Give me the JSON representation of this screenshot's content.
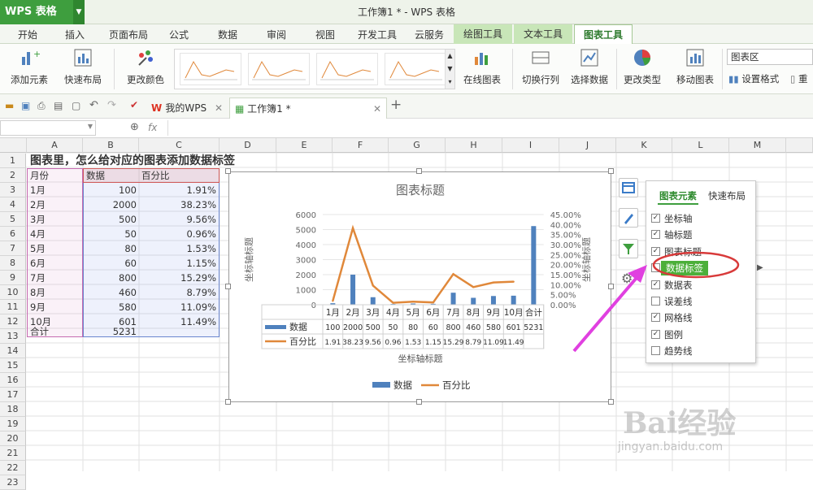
{
  "app": {
    "name": "WPS 表格",
    "window_title": "工作簿1 * - WPS 表格"
  },
  "ribbon_tabs": [
    "开始",
    "插入",
    "页面布局",
    "公式",
    "数据",
    "审阅",
    "视图",
    "开发工具",
    "云服务",
    "绘图工具",
    "文本工具",
    "图表工具"
  ],
  "active_tab": "图表工具",
  "ribbon": {
    "add_element": "添加元素",
    "quick_layout": "快速布局",
    "change_color": "更改颜色",
    "online_chart": "在线图表",
    "switch_row_col": "切换行列",
    "select_data": "选择数据",
    "change_type": "更改类型",
    "move_chart": "移动图表",
    "set_format": "设置格式",
    "reset": "重",
    "element_selector": "图表区"
  },
  "doc_tabs": [
    {
      "label": "我的WPS"
    },
    {
      "label": "工作簿1 *"
    }
  ],
  "formula": {
    "fx": "fx"
  },
  "columns": [
    "A",
    "B",
    "C",
    "D",
    "E",
    "F",
    "G",
    "H",
    "I",
    "J",
    "K",
    "L",
    "M"
  ],
  "rows": [
    "1",
    "2",
    "3",
    "4",
    "5",
    "6",
    "7",
    "8",
    "9",
    "10",
    "11",
    "12",
    "13",
    "14",
    "15",
    "16",
    "17",
    "18",
    "19",
    "20",
    "21",
    "22",
    "23"
  ],
  "sheet": {
    "title": "图表里，怎么给对应的图表添加数据标签",
    "headers": [
      "月份",
      "数据",
      "百分比"
    ],
    "data": [
      [
        "1月",
        "100",
        "1.91%"
      ],
      [
        "2月",
        "2000",
        "38.23%"
      ],
      [
        "3月",
        "500",
        "9.56%"
      ],
      [
        "4月",
        "50",
        "0.96%"
      ],
      [
        "5月",
        "80",
        "1.53%"
      ],
      [
        "6月",
        "60",
        "1.15%"
      ],
      [
        "7月",
        "800",
        "15.29%"
      ],
      [
        "8月",
        "460",
        "8.79%"
      ],
      [
        "9月",
        "580",
        "11.09%"
      ],
      [
        "10月",
        "601",
        "11.49%"
      ]
    ],
    "total_label": "合计",
    "total_value": "5231"
  },
  "chart_data": {
    "type": "bar",
    "title": "图表标题",
    "xlabel": "坐标轴标题",
    "ylabel": "坐标轴标题",
    "y2label": "坐标轴标题",
    "categories": [
      "1月",
      "2月",
      "3月",
      "4月",
      "5月",
      "6月",
      "7月",
      "8月",
      "9月",
      "10月",
      "合计"
    ],
    "ylim": [
      0,
      6000
    ],
    "y2lim": [
      0,
      45
    ],
    "yticks": [
      "6000",
      "5000",
      "4000",
      "3000",
      "2000",
      "1000",
      "0"
    ],
    "y2ticks": [
      "45.00%",
      "40.00%",
      "35.00%",
      "30.00%",
      "25.00%",
      "20.00%",
      "15.00%",
      "10.00%",
      "5.00%",
      "0.00%"
    ],
    "series": [
      {
        "name": "数据",
        "type": "bar",
        "axis": "left",
        "color": "#4f81bd",
        "values": [
          100,
          2000,
          500,
          50,
          80,
          60,
          800,
          460,
          580,
          601,
          5231
        ],
        "labels": [
          "100",
          "2000",
          "500",
          "50",
          "80",
          "60",
          "800",
          "460",
          "580",
          "601",
          "5231"
        ]
      },
      {
        "name": "百分比",
        "type": "line",
        "axis": "right",
        "color": "#e0883a",
        "values": [
          1.91,
          38.23,
          9.56,
          0.96,
          1.53,
          1.15,
          15.29,
          8.79,
          11.09,
          11.49
        ],
        "labels": [
          "1.91",
          "38.23",
          "9.56",
          "0.96",
          "1.53",
          "1.15",
          "15.29",
          "8.79",
          "11.09",
          "11.49"
        ]
      }
    ],
    "legend": "bottom",
    "data_table": true
  },
  "panel": {
    "tabs": [
      "图表元素",
      "快速布局"
    ],
    "items": [
      {
        "label": "坐标轴",
        "checked": true
      },
      {
        "label": "轴标题",
        "checked": true
      },
      {
        "label": "图表标题",
        "checked": true
      },
      {
        "label": "数据标签",
        "checked": false,
        "highlight": true
      },
      {
        "label": "数据表",
        "checked": true
      },
      {
        "label": "误差线",
        "checked": false
      },
      {
        "label": "网格线",
        "checked": true
      },
      {
        "label": "图例",
        "checked": true
      },
      {
        "label": "趋势线",
        "checked": false
      }
    ]
  },
  "watermark": {
    "text": "Bai经验",
    "sub": "jingyan.baidu.com"
  },
  "colors": {
    "accent": "#3e9e3e",
    "bar": "#4f81bd",
    "line": "#e0883a",
    "annotation": "#e040e0",
    "highlight": "#4caf3a"
  }
}
